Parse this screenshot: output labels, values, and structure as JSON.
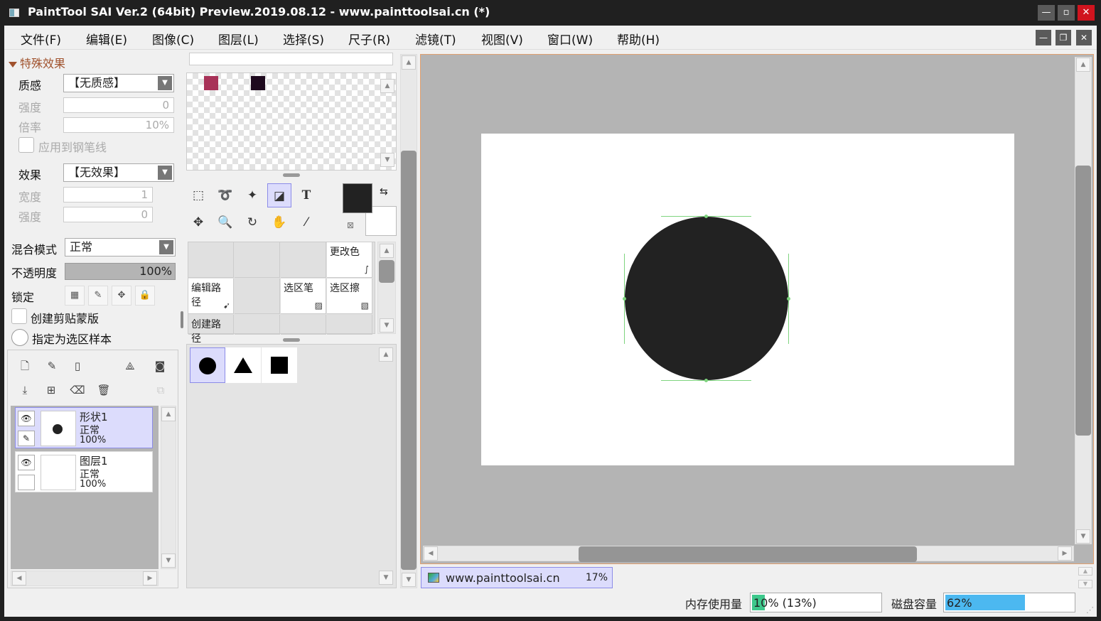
{
  "window": {
    "title": "PaintTool SAI Ver.2 (64bit) Preview.2019.08.12 - www.painttoolsai.cn (*)"
  },
  "menu": [
    "文件(F)",
    "编辑(E)",
    "图像(C)",
    "图层(L)",
    "选择(S)",
    "尺子(R)",
    "滤镜(T)",
    "视图(V)",
    "窗口(W)",
    "帮助(H)"
  ],
  "effects": {
    "section_title": "特殊效果",
    "texture_label": "质感",
    "texture_value": "【无质感】",
    "strength_label": "强度",
    "strength_value": "0",
    "scale_label": "倍率",
    "scale_value": "10%",
    "apply_pen_label": "应用到钢笔线",
    "effect_label": "效果",
    "effect_value": "【无效果】",
    "width_label": "宽度",
    "width_value": "1",
    "strength2_label": "强度",
    "strength2_value": "0"
  },
  "layer_props": {
    "blend_label": "混合模式",
    "blend_value": "正常",
    "opacity_label": "不透明度",
    "opacity_value": "100%",
    "lock_label": "锁定",
    "clip_label": "创建剪贴蒙版",
    "sample_label": "指定为选区样本"
  },
  "layers": [
    {
      "name": "形状1",
      "mode": "正常",
      "opacity": "100%"
    },
    {
      "name": "图层1",
      "mode": "正常",
      "opacity": "100%"
    }
  ],
  "swatch_colors": [
    "#a83258",
    "#1e0a1e"
  ],
  "subtools": {
    "change_color": "更改色",
    "edit_path": "编辑路径",
    "sel_pen": "选区笔",
    "sel_eraser": "选区擦",
    "create_path": "创建路径"
  },
  "document": {
    "name": "www.painttoolsai.cn",
    "zoom": "17%"
  },
  "status": {
    "memory_label": "内存使用量",
    "memory_value": "10% (13%)",
    "memory_fraction": 0.1,
    "disk_label": "磁盘容量",
    "disk_value": "62%",
    "disk_fraction": 0.62
  },
  "colors": {
    "selection_highlight": "#dcdcfc",
    "accent_section": "#a0522d",
    "memory_fill": "#3ec88c",
    "disk_fill": "#4cb8f0",
    "foreground_color": "#222222",
    "background_color": "#ffffff"
  }
}
